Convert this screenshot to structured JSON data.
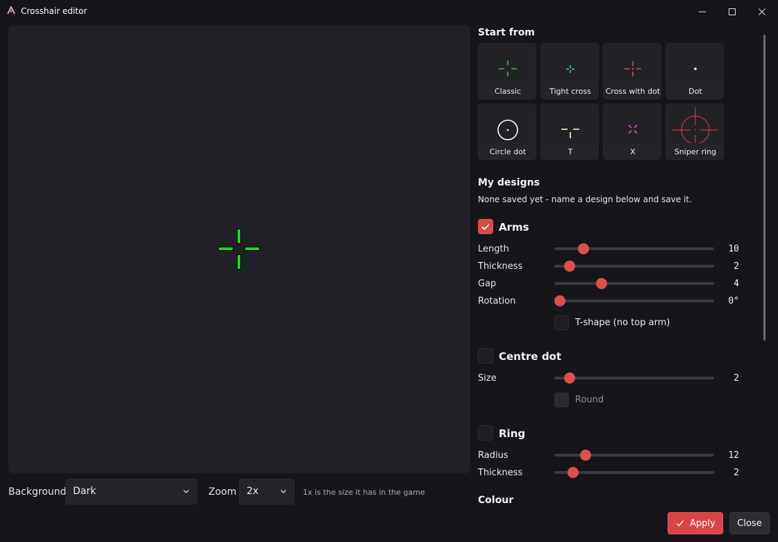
{
  "window": {
    "title": "Crosshair editor",
    "icons": [
      "app-icon",
      "minimize-icon",
      "maximize-icon",
      "close-icon"
    ]
  },
  "preview": {
    "crosshair_color": "#1fd41f",
    "outline_color": "#000000",
    "background_color": "#202126"
  },
  "bottom": {
    "background_label": "Background",
    "background_value": "Dark",
    "zoom_label": "Zoom",
    "zoom_value": "2x",
    "hint": "1x is the size it has in the game"
  },
  "start_from": {
    "title": "Start from",
    "presets": [
      {
        "label": "Classic",
        "color": "#2bd42b"
      },
      {
        "label": "Tight cross",
        "color": "#39d5d5"
      },
      {
        "label": "Cross with dot",
        "color": "#e04b4b"
      },
      {
        "label": "Dot",
        "color": "#ffffff"
      },
      {
        "label": "Circle dot",
        "color": "#ffffff"
      },
      {
        "label": "T",
        "color": "#f0e6a0"
      },
      {
        "label": "X",
        "color": "#e05bd6"
      },
      {
        "label": "Sniper ring",
        "color": "#e04040"
      }
    ]
  },
  "my_designs": {
    "title": "My designs",
    "empty_note": "None saved yet - name a design below and save it."
  },
  "arms": {
    "title": "Arms",
    "enabled": true,
    "sliders": [
      {
        "label": "Length",
        "value": "10",
        "fraction": 0.18
      },
      {
        "label": "Thickness",
        "value": "2",
        "fraction": 0.1
      },
      {
        "label": "Gap",
        "value": "4",
        "fraction": 0.3
      },
      {
        "label": "Rotation",
        "value": "0°",
        "fraction": 0.03
      }
    ],
    "t_shape_label": "T-shape (no top arm)",
    "t_shape": false
  },
  "centre_dot": {
    "title": "Centre dot",
    "enabled": false,
    "size_label": "Size",
    "size_value": "2",
    "size_fraction": 0.1,
    "round_label": "Round",
    "round": false
  },
  "ring": {
    "title": "Ring",
    "enabled": false,
    "radius_label": "Radius",
    "radius_value": "12",
    "radius_fraction": 0.19,
    "thickness_label": "Thickness",
    "thickness_value": "2",
    "thickness_fraction": 0.12
  },
  "colour": {
    "title": "Colour"
  },
  "actions": {
    "apply_label": "Apply",
    "close_label": "Close"
  },
  "accent": "#d94545"
}
